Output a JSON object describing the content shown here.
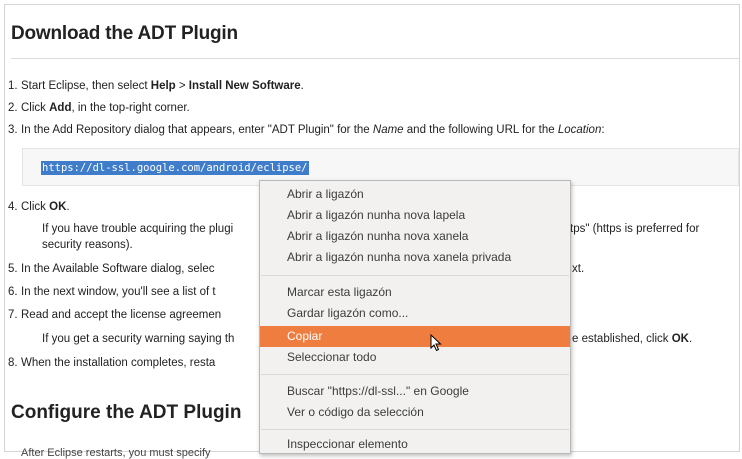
{
  "page": {
    "heading": "Download the ADT Plugin",
    "steps": [
      {
        "num": "1.",
        "pre": "Start Eclipse, then select ",
        "b1": "Help",
        "mid": " > ",
        "b2": "Install New Software",
        "post": "."
      },
      {
        "num": "2.",
        "pre": "Click ",
        "b1": "Add",
        "post": ", in the top-right corner."
      },
      {
        "num": "3.",
        "pre": "In the Add Repository dialog that appears, enter \"ADT Plugin\" for the ",
        "i1": "Name",
        "mid": " and the following URL for the ",
        "i2": "Location",
        "post": ":"
      }
    ],
    "url": "https://dl-ssl.google.com/android/eclipse/",
    "step4": {
      "num": "4.",
      "pre": "Click ",
      "b1": "OK",
      "post": "."
    },
    "step4_sub_left": "If you have trouble acquiring the plugi",
    "step4_sub_right": "tps\" (https is preferred for",
    "step4_sub2": "security reasons).",
    "step5": {
      "num": "5.",
      "text": "In the Available Software dialog, selec",
      "right": "xt."
    },
    "step6": {
      "num": "6.",
      "text": "In the next window, you'll see a list of t"
    },
    "step7": {
      "num": "7.",
      "text": "Read and accept the license agreemen"
    },
    "step7_sub_left": "If you get a security warning saying th",
    "step7_sub_right_pre": "e established, click ",
    "step7_sub_right_b": "OK",
    "step7_sub_right_post": ".",
    "step8": {
      "num": "8.",
      "text": "When the installation completes, resta"
    },
    "section2_heading": "Configure the ADT Plugin",
    "bottom_text": "After Eclipse restarts, you must specify"
  },
  "context_menu": {
    "items": [
      {
        "label": "Abrir a ligazón"
      },
      {
        "label": "Abrir a ligazón nunha nova lapela"
      },
      {
        "label": "Abrir a ligazón nunha nova xanela"
      },
      {
        "label": "Abrir a ligazón nunha nova xanela privada"
      },
      {
        "label": "Marcar esta ligazón"
      },
      {
        "label": "Gardar ligazón como..."
      },
      {
        "label": "Copiar",
        "highlighted": true
      },
      {
        "label": "Seleccionar todo"
      },
      {
        "label": "Buscar \"https://dl-ssl...\" en Google"
      },
      {
        "label": "Ver o código da selección"
      },
      {
        "label": "Inspeccionar elemento"
      }
    ]
  },
  "colors": {
    "menu_highlight": "#ef7d3f",
    "url_selection": "#3f7cc9",
    "menu_background": "#f2f1f0"
  }
}
